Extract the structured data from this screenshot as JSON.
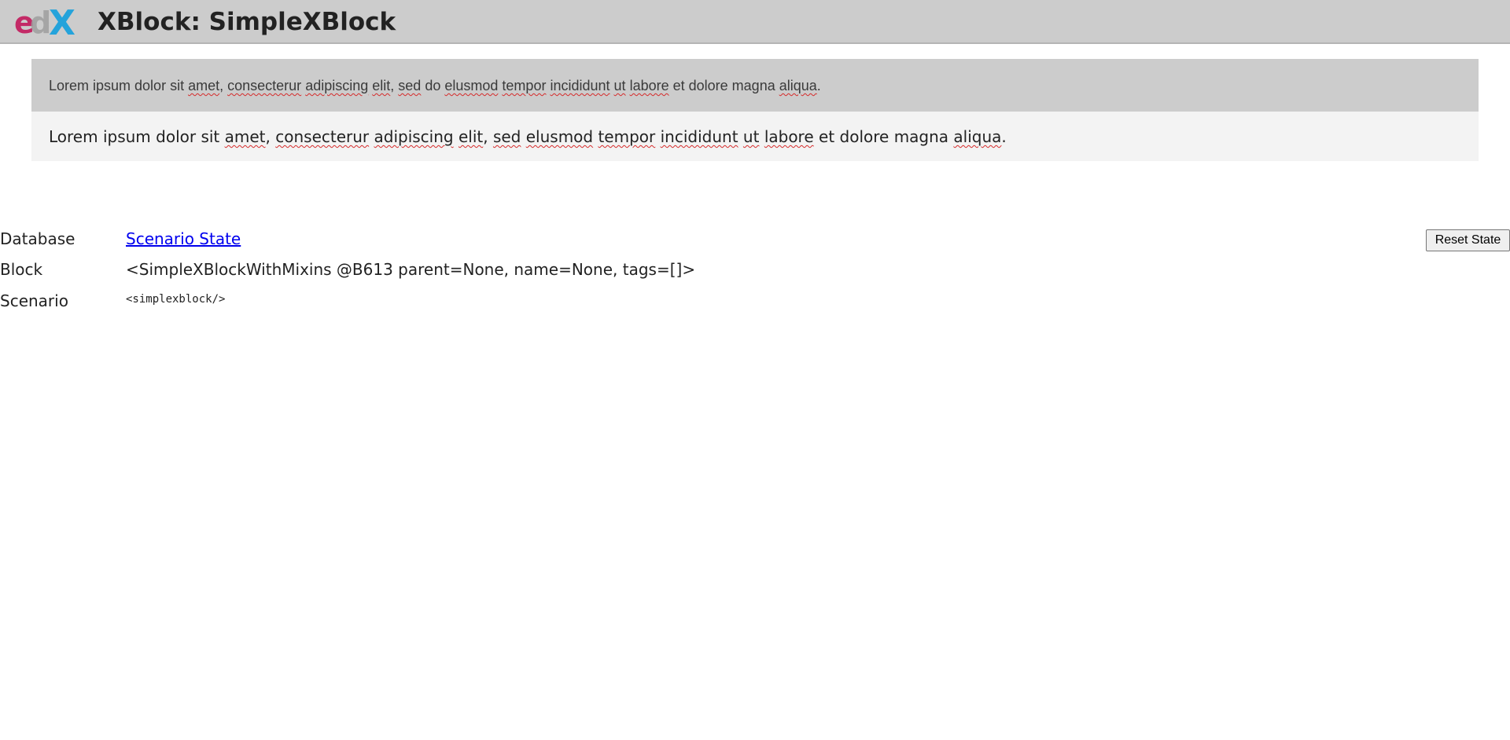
{
  "header": {
    "logo_text": "edX",
    "title": "XBlock: SimpleXBlock"
  },
  "panels": {
    "gray_text_words": [
      "Lorem ipsum dolor sit ",
      "amet",
      ", ",
      "consecterur",
      " ",
      "adipiscing",
      " ",
      "elit",
      ", ",
      "sed",
      " do ",
      "elusmod",
      " ",
      "tempor",
      " ",
      "incididunt",
      " ",
      "ut",
      " ",
      "labore",
      " et dolore magna ",
      "aliqua",
      "."
    ],
    "light_text_words": [
      "Lorem ipsum dolor sit ",
      "amet",
      ", ",
      "consecterur",
      " ",
      "adipiscing",
      " ",
      "elit",
      ", ",
      "sed",
      " ",
      "elusmod",
      " ",
      "tempor",
      " ",
      "incididunt",
      " ",
      "ut",
      " ",
      "labore",
      " et dolore magna ",
      "aliqua",
      "."
    ]
  },
  "info": {
    "database_label": "Database",
    "database_link": "Scenario State",
    "block_label": "Block",
    "block_value": "<SimpleXBlockWithMixins @B613 parent=None, name=None, tags=[]>",
    "scenario_label": "Scenario",
    "scenario_value": "<simplexblock/>"
  },
  "buttons": {
    "reset_label": "Reset State"
  },
  "colors": {
    "topbar": "#cccccc",
    "panel_gray": "#cccccc",
    "panel_light": "#f3f3f3",
    "link": "#0000ee",
    "spellcheck": "#d62a2a",
    "logo_pink": "#c2185b",
    "logo_gray": "#9e9e9e",
    "logo_blue": "#1aa0db"
  }
}
